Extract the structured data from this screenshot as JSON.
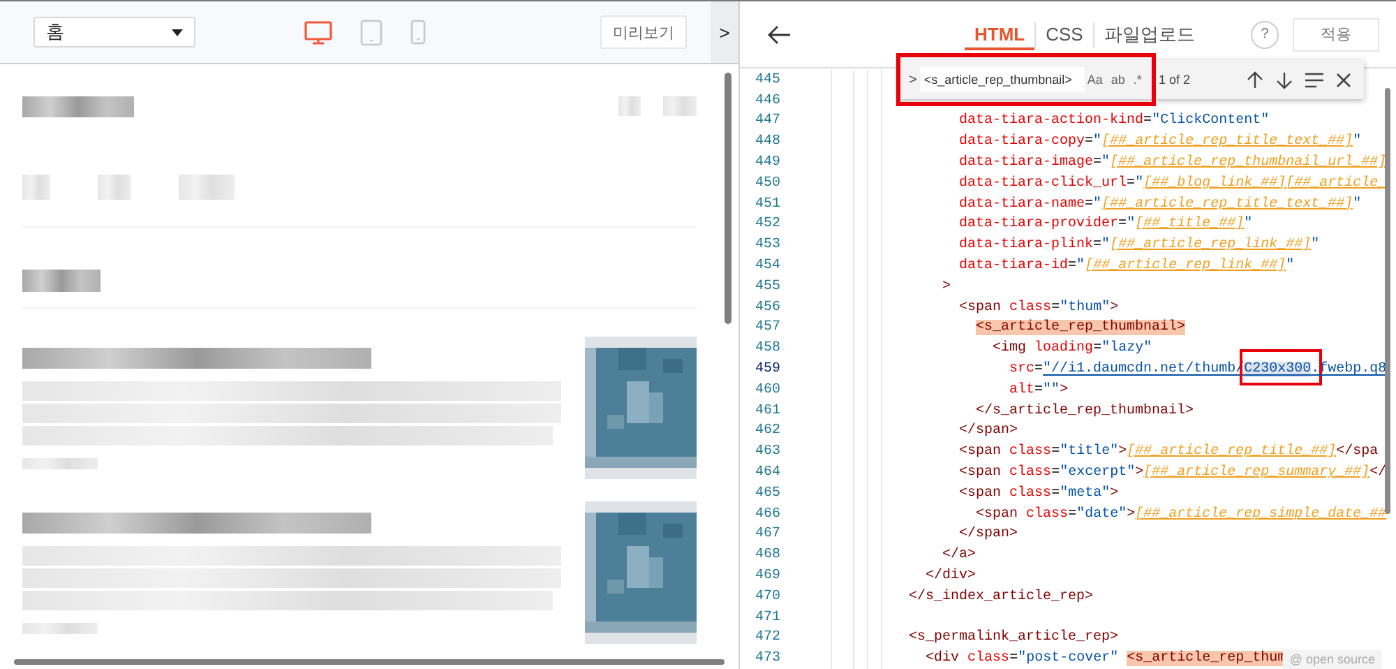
{
  "preview_toolbar": {
    "page_select": {
      "value": "홈"
    },
    "devices": [
      {
        "kind": "desktop",
        "selected": true
      },
      {
        "kind": "tablet",
        "selected": false
      },
      {
        "kind": "mobile",
        "selected": false
      }
    ],
    "preview_button": "미리보기",
    "collapse_button": ">"
  },
  "editor_toolbar": {
    "tabs": [
      {
        "label": "HTML",
        "selected": true
      },
      {
        "label": "CSS",
        "selected": false
      },
      {
        "label": "파일업로드",
        "selected": false
      }
    ],
    "help_button": "?",
    "apply_button": "적용"
  },
  "find_widget": {
    "toggle": ">",
    "value": "<s_article_rep_thumbnail>",
    "options": [
      {
        "label": "Aa"
      },
      {
        "label": "ab"
      },
      {
        "label": ".*"
      }
    ],
    "match_count": "1 of 2",
    "boxed": true
  },
  "code_lines": [
    {
      "number": "445",
      "current": false
    },
    {
      "number": "446",
      "current": false
    },
    {
      "number": "447",
      "current": false,
      "tokens": [
        {
          "kind": "attr",
          "text": "      data-tiara-action-kind"
        },
        {
          "kind": "punct",
          "text": "="
        },
        {
          "kind": "str",
          "text": "\"ClickContent\""
        }
      ]
    },
    {
      "number": "448",
      "current": false,
      "tokens": [
        {
          "kind": "attr",
          "text": "      data-tiara-copy"
        },
        {
          "kind": "punct",
          "text": "="
        },
        {
          "kind": "str",
          "text": "\""
        },
        {
          "kind": "tpl",
          "text": "[##_article_rep_title_text_##]"
        },
        {
          "kind": "str",
          "text": "\""
        }
      ]
    },
    {
      "number": "449",
      "current": false,
      "tokens": [
        {
          "kind": "attr",
          "text": "      data-tiara-image"
        },
        {
          "kind": "punct",
          "text": "="
        },
        {
          "kind": "str",
          "text": "\""
        },
        {
          "kind": "tpl",
          "text": "[##_article_rep_thumbnail_url_##]"
        }
      ]
    },
    {
      "number": "450",
      "current": false,
      "tokens": [
        {
          "kind": "attr",
          "text": "      data-tiara-click_url"
        },
        {
          "kind": "punct",
          "text": "="
        },
        {
          "kind": "str",
          "text": "\""
        },
        {
          "kind": "tpl",
          "text": "[##_blog_link_##][##_article_"
        }
      ]
    },
    {
      "number": "451",
      "current": false,
      "tokens": [
        {
          "kind": "attr",
          "text": "      data-tiara-name"
        },
        {
          "kind": "punct",
          "text": "="
        },
        {
          "kind": "str",
          "text": "\""
        },
        {
          "kind": "tpl",
          "text": "[##_article_rep_title_text_##]"
        },
        {
          "kind": "str",
          "text": "\""
        }
      ]
    },
    {
      "number": "452",
      "current": false,
      "tokens": [
        {
          "kind": "attr",
          "text": "      data-tiara-provider"
        },
        {
          "kind": "punct",
          "text": "="
        },
        {
          "kind": "str",
          "text": "\""
        },
        {
          "kind": "tpl",
          "text": "[##_title_##]"
        },
        {
          "kind": "str",
          "text": "\""
        }
      ]
    },
    {
      "number": "453",
      "current": false,
      "tokens": [
        {
          "kind": "attr",
          "text": "      data-tiara-plink"
        },
        {
          "kind": "punct",
          "text": "="
        },
        {
          "kind": "str",
          "text": "\""
        },
        {
          "kind": "tpl",
          "text": "[##_article_rep_link_##]"
        },
        {
          "kind": "str",
          "text": "\""
        }
      ]
    },
    {
      "number": "454",
      "current": false,
      "tokens": [
        {
          "kind": "attr",
          "text": "      data-tiara-id"
        },
        {
          "kind": "punct",
          "text": "="
        },
        {
          "kind": "str",
          "text": "\""
        },
        {
          "kind": "tpl",
          "text": "[##_article_rep_link_##]"
        },
        {
          "kind": "str",
          "text": "\""
        }
      ]
    },
    {
      "number": "455",
      "current": false,
      "tokens": [
        {
          "kind": "tag",
          "text": "    >"
        }
      ]
    },
    {
      "number": "456",
      "current": false,
      "tokens": [
        {
          "kind": "tag",
          "text": "      <span"
        },
        {
          "kind": "attr",
          "text": " class"
        },
        {
          "kind": "punct",
          "text": "="
        },
        {
          "kind": "str",
          "text": "\"thum\""
        },
        {
          "kind": "tag",
          "text": ">"
        }
      ]
    },
    {
      "number": "457",
      "current": false,
      "tokens": [
        {
          "kind": "tag",
          "text": "        <s_article_rep_thumbnail>",
          "highlighted": true
        }
      ]
    },
    {
      "number": "458",
      "current": false,
      "tokens": [
        {
          "kind": "tag",
          "text": "          <img"
        },
        {
          "kind": "attr",
          "text": " loading"
        },
        {
          "kind": "punct",
          "text": "="
        },
        {
          "kind": "str",
          "text": "\"lazy\""
        }
      ]
    },
    {
      "number": "459",
      "current": true,
      "tokens": [
        {
          "kind": "attr",
          "text": "            src"
        },
        {
          "kind": "punct",
          "text": "="
        },
        {
          "kind": "url",
          "text": "\"//i1.daumcdn.net/thumb/"
        },
        {
          "kind": "url",
          "text": "C230x300",
          "selected": true,
          "boxed": true
        },
        {
          "kind": "url",
          "text": ".fwebp.q8"
        }
      ]
    },
    {
      "number": "460",
      "current": false,
      "tokens": [
        {
          "kind": "attr",
          "text": "            alt"
        },
        {
          "kind": "punct",
          "text": "="
        },
        {
          "kind": "str",
          "text": "\"\""
        },
        {
          "kind": "tag",
          "text": ">"
        }
      ]
    },
    {
      "number": "461",
      "current": false,
      "tokens": [
        {
          "kind": "tag",
          "text": "        </s_article_rep_thumbnail>"
        }
      ]
    },
    {
      "number": "462",
      "current": false,
      "tokens": [
        {
          "kind": "tag",
          "text": "      </span>"
        }
      ]
    },
    {
      "number": "463",
      "current": false,
      "tokens": [
        {
          "kind": "tag",
          "text": "      <span"
        },
        {
          "kind": "attr",
          "text": " class"
        },
        {
          "kind": "punct",
          "text": "="
        },
        {
          "kind": "str",
          "text": "\"title\""
        },
        {
          "kind": "tag",
          "text": ">"
        },
        {
          "kind": "tpl",
          "text": "[##_article_rep_title_##]"
        },
        {
          "kind": "tag",
          "text": "</spa"
        }
      ]
    },
    {
      "number": "464",
      "current": false,
      "tokens": [
        {
          "kind": "tag",
          "text": "      <span"
        },
        {
          "kind": "attr",
          "text": " class"
        },
        {
          "kind": "punct",
          "text": "="
        },
        {
          "kind": "str",
          "text": "\"excerpt\""
        },
        {
          "kind": "tag",
          "text": ">"
        },
        {
          "kind": "tpl",
          "text": "[##_article_rep_summary_##]"
        },
        {
          "kind": "tag",
          "text": "</"
        }
      ]
    },
    {
      "number": "465",
      "current": false,
      "tokens": [
        {
          "kind": "tag",
          "text": "      <span"
        },
        {
          "kind": "attr",
          "text": " class"
        },
        {
          "kind": "punct",
          "text": "="
        },
        {
          "kind": "str",
          "text": "\"meta\""
        },
        {
          "kind": "tag",
          "text": ">"
        }
      ]
    },
    {
      "number": "466",
      "current": false,
      "tokens": [
        {
          "kind": "tag",
          "text": "        <span"
        },
        {
          "kind": "attr",
          "text": " class"
        },
        {
          "kind": "punct",
          "text": "="
        },
        {
          "kind": "str",
          "text": "\"date\""
        },
        {
          "kind": "tag",
          "text": ">"
        },
        {
          "kind": "tpl",
          "text": "[##_article_rep_simple_date_##"
        }
      ]
    },
    {
      "number": "467",
      "current": false,
      "tokens": [
        {
          "kind": "tag",
          "text": "      </span>"
        }
      ]
    },
    {
      "number": "468",
      "current": false,
      "tokens": [
        {
          "kind": "tag",
          "text": "    </a>"
        }
      ]
    },
    {
      "number": "469",
      "current": false,
      "tokens": [
        {
          "kind": "tag",
          "text": "  </div>"
        }
      ]
    },
    {
      "number": "470",
      "current": false,
      "tokens": [
        {
          "kind": "tag",
          "text": "</s_index_article_rep>"
        }
      ]
    },
    {
      "number": "471",
      "current": false
    },
    {
      "number": "472",
      "current": false,
      "tokens": [
        {
          "kind": "tag",
          "text": "<s_permalink_article_rep>"
        }
      ]
    },
    {
      "number": "473",
      "current": false,
      "tokens": [
        {
          "kind": "tag",
          "text": "  <div"
        },
        {
          "kind": "attr",
          "text": " class"
        },
        {
          "kind": "punct",
          "text": "="
        },
        {
          "kind": "str",
          "text": "\"post-cover\""
        },
        {
          "kind": "tag",
          "text": " <s_article_rep_thum",
          "highlighted": true
        }
      ]
    }
  ],
  "source_badge": "@ open source"
}
